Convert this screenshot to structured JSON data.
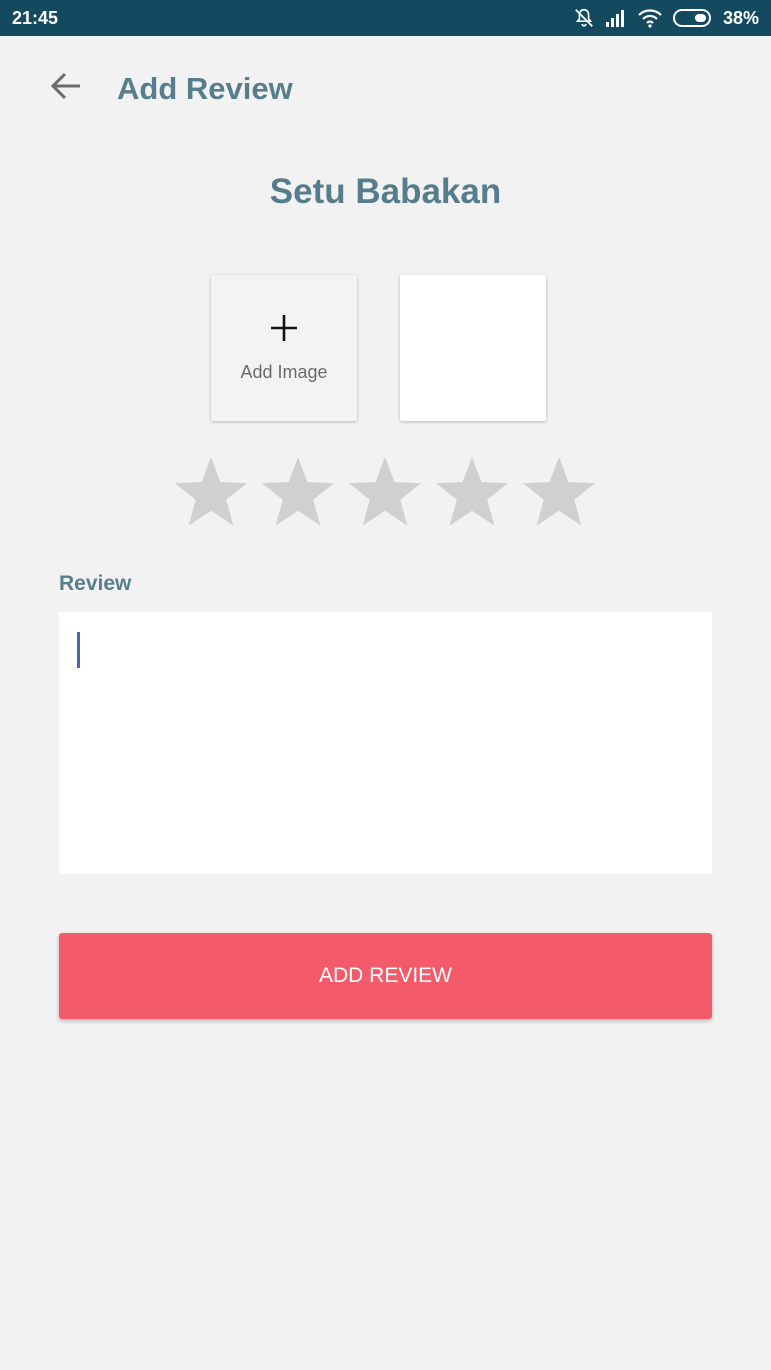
{
  "status_bar": {
    "time": "21:45",
    "battery": "38%",
    "icons": [
      "notifications-off-icon",
      "signal-icon",
      "wifi-icon",
      "battery-icon"
    ]
  },
  "header": {
    "title": "Add Review",
    "back_icon": "arrow-back-icon"
  },
  "place": {
    "name": "Setu Babakan"
  },
  "images": {
    "add_label": "Add Image",
    "add_icon": "plus-icon"
  },
  "rating": {
    "max": 5,
    "value": 0,
    "empty_color": "#d0d0d0"
  },
  "review": {
    "label": "Review",
    "value": ""
  },
  "submit": {
    "label": "ADD REVIEW",
    "color": "#f45b6a"
  },
  "colors": {
    "status_bar": "#134a5f",
    "accent_text": "#567e8c",
    "background": "#f2f2f2"
  }
}
